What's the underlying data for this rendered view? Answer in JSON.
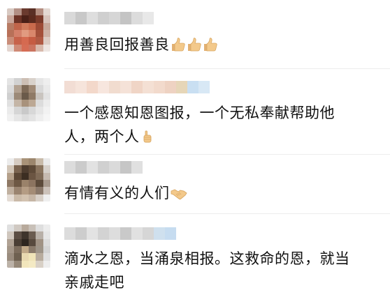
{
  "comments": [
    {
      "text": "用善良回报善良",
      "reactions": [
        "thumbs-up-icon",
        "thumbs-up-icon",
        "thumbs-up-icon"
      ]
    },
    {
      "text_line1": "一个感恩知恩图报，一个无私奉献帮助他",
      "text_line2": "人，两个人",
      "reactions": [
        "thumbs-up-icon"
      ]
    },
    {
      "text": "有情有义的人们",
      "reactions": [
        "handshake-icon"
      ]
    },
    {
      "text_line1": "滴水之恩，当涌泉相报。这救命的恩，就当",
      "text_line2": "亲戚走吧"
    }
  ],
  "colors": {
    "text": "#111111",
    "divider": "#ededed",
    "thumb": "#f3c98b"
  }
}
